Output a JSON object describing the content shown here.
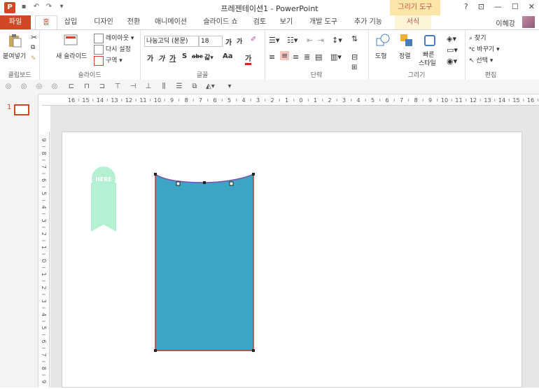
{
  "window": {
    "title": "프레젠테이션1 - PowerPoint",
    "context_tab_group": "그리기 도구",
    "help": "?",
    "buttons": [
      "?",
      "⊡",
      "—",
      "☐",
      "✕"
    ]
  },
  "tabs": [
    {
      "label": "파일",
      "kind": "file"
    },
    {
      "label": "홈",
      "kind": "active"
    },
    {
      "label": "삽입"
    },
    {
      "label": "디자인"
    },
    {
      "label": "전환"
    },
    {
      "label": "애니메이션"
    },
    {
      "label": "슬라이드 쇼"
    },
    {
      "label": "검토"
    },
    {
      "label": "보기"
    },
    {
      "label": "개발 도구"
    },
    {
      "label": "추가 기능"
    },
    {
      "label": "서식",
      "kind": "format"
    }
  ],
  "user": {
    "name": "이혜강"
  },
  "ribbon": {
    "clipboard": {
      "paste": "붙여넣기",
      "label": "클립보드"
    },
    "slides": {
      "new_slide": "새 슬라이드",
      "layout": "레이아웃",
      "reset": "다시 설정",
      "section": "구역",
      "label": "슬라이드"
    },
    "font": {
      "font_name": "나눔고딕 (본문)",
      "font_size": "18",
      "label": "글꼴",
      "change_case": "Aa"
    },
    "paragraph": {
      "label": "단락"
    },
    "drawing": {
      "shape": "도형",
      "arrange": "정렬",
      "quick_styles_1": "빠른",
      "quick_styles_2": "스타일",
      "label": "그리기"
    },
    "editing": {
      "find": "찾기",
      "replace": "바꾸기",
      "select": "선택",
      "label": "편집"
    }
  },
  "slides_panel": {
    "number": "1"
  },
  "ruler": {
    "h_ticks": [
      "16",
      "15",
      "14",
      "13",
      "12",
      "11",
      "10",
      "9",
      "8",
      "7",
      "6",
      "5",
      "4",
      "3",
      "2",
      "1",
      "0",
      "1",
      "2",
      "3",
      "4",
      "5",
      "6",
      "7",
      "8",
      "9",
      "10",
      "11",
      "12",
      "13",
      "14",
      "15",
      "16"
    ],
    "v_ticks": [
      "9",
      "8",
      "7",
      "6",
      "5",
      "4",
      "3",
      "2",
      "1",
      "0",
      "1",
      "2",
      "3",
      "4",
      "5",
      "6",
      "7",
      "8",
      "9"
    ]
  },
  "slide": {
    "badge_text": "HERE",
    "colors": {
      "badge": "#b3f1d2",
      "shape_fill": "#3ca5c4",
      "shape_outline": "#c0392b",
      "curve": "#6a5acd"
    }
  }
}
